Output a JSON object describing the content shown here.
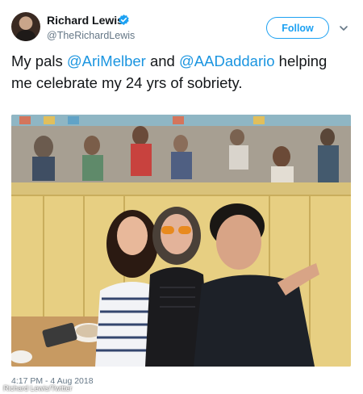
{
  "account": {
    "display_name": "Richard Lewis",
    "handle": "@TheRichardLewis",
    "verified": true
  },
  "actions": {
    "follow_label": "Follow"
  },
  "tweet": {
    "text_before": "My pals ",
    "mention_1": "@AriMelber",
    "text_middle": " and ",
    "mention_2": "@AADaddario",
    "text_after": " helping me celebrate my 24 yrs of sobriety.",
    "timestamp": "4:17 PM - 4 Aug 2018"
  },
  "media": {
    "watermark": "Richard Lewis/Twitter"
  },
  "colors": {
    "accent": "#1da1f2",
    "mention": "#1b95e0",
    "secondary_text": "#657786"
  },
  "icons": [
    "verified-badge-icon",
    "chevron-down-icon"
  ]
}
